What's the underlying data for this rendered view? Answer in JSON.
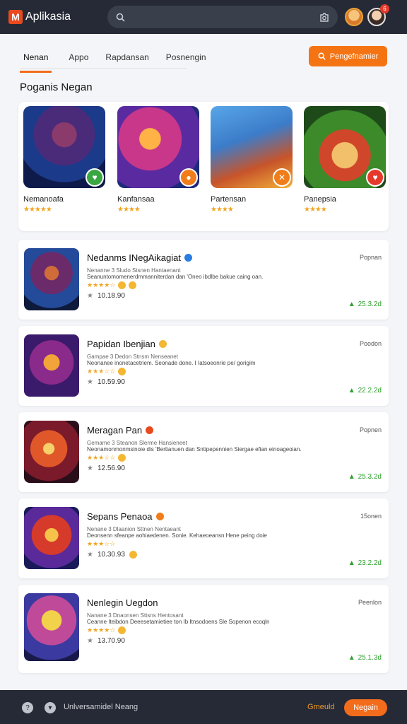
{
  "app": {
    "title": "Aplikasia",
    "logo_letter": "M"
  },
  "header": {
    "notification_count": "6"
  },
  "tabs": [
    {
      "label": "Nenan"
    },
    {
      "label": "Appo"
    },
    {
      "label": "Rapdansan"
    },
    {
      "label": "Posnengin"
    }
  ],
  "primary_action": {
    "label": "Pengefnamier"
  },
  "section": {
    "title": "Poganis Negan"
  },
  "featured": [
    {
      "name": "Nemanoafa",
      "stars": "★★★★★",
      "badge_color": "#3aa743"
    },
    {
      "name": "Kanfansaa",
      "stars": "★★★★",
      "badge_color": "#f07d1a"
    },
    {
      "name": "Partensan",
      "stars": "★★★★",
      "badge_color": "#f07d1a"
    },
    {
      "name": "Panepsia",
      "stars": "★★★★",
      "badge_color": "#e53a2b"
    }
  ],
  "apps": [
    {
      "title": "Nedanms INegAikagiat",
      "sub": "Nenanne 3 Sludo Stsnen Hantaenant",
      "desc": "Seanuntomomenerdmmanniterdan dan 'Oneo ibdlbe bakue caing oan.",
      "stars": "★★★★☆",
      "downloads": "10.18.90",
      "tag": "Popnan",
      "price": "25.3.2d"
    },
    {
      "title": "Papidan Ibenjian",
      "sub": "Gampae 3 Dedon Stnsm Nenseanet",
      "desc": "Neonanee inonetacetriem. Seonade done. I Iatsoeonrie pe/ gorigim",
      "stars": "★★★☆☆",
      "downloads": "10.59.90",
      "tag": "Poodon",
      "price": "22.2.2d"
    },
    {
      "title": "Meragan Pan",
      "sub": "Gemame 3 Steanon Slerme Hansieneet",
      "desc": "Neonamonmonmsinoie dis 'Bertianuen dan Sntipepennien Siergae efian einoageoian.",
      "stars": "★★★☆☆",
      "downloads": "12.56.90",
      "tag": "Popnen",
      "price": "25.3.2d"
    },
    {
      "title": "Sepans Penaoa",
      "sub": "Nenane 3 Dlaanion Sttnen Nentaeant",
      "desc": "Deonsenn sfeanpe aohiaedenen. Sonie. Kehaeoeansn Hene peing doie",
      "stars": "★★★☆☆",
      "downloads": "10.30.93",
      "tag": "15onen",
      "price": "23.2.2d"
    },
    {
      "title": "Nenlegin Uegdon",
      "sub": "Nanane 3 Dnaonsen Sttsns Hentosant",
      "desc": "Ceanne Iteibdon Deeesetamietiee ton Ib Itnsodoens Sle Sopenon ecoqln",
      "stars": "★★★★☆",
      "downloads": "13.70.90",
      "tag": "Peenlon",
      "price": "25.1.3d"
    }
  ],
  "bottom": {
    "text": "Unlversamidel Neang",
    "link": "Gmeuld",
    "button": "Negain"
  }
}
